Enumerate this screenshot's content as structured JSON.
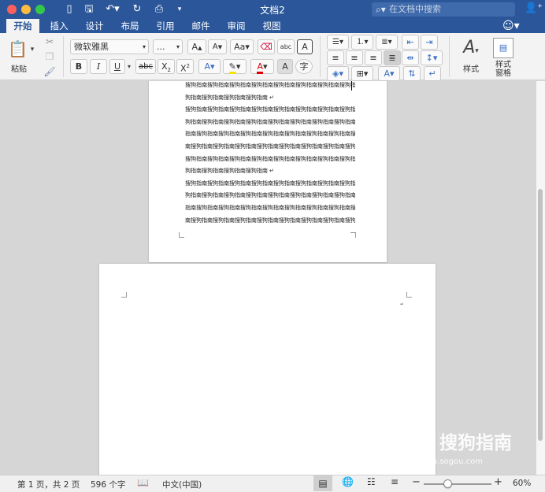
{
  "window": {
    "title": "文档2"
  },
  "search": {
    "placeholder": "在文档中搜索"
  },
  "tabs": [
    {
      "label": "开始",
      "active": true
    },
    {
      "label": "插入"
    },
    {
      "label": "设计"
    },
    {
      "label": "布局"
    },
    {
      "label": "引用"
    },
    {
      "label": "邮件"
    },
    {
      "label": "审阅"
    },
    {
      "label": "视图"
    }
  ],
  "ribbon": {
    "paste_label": "粘贴",
    "font_name": "微软雅黑",
    "font_size": "...",
    "bold": "B",
    "italic": "I",
    "underline": "U",
    "strike": "abc",
    "styles_label": "样式",
    "styles_pane_label": "样式\n窗格",
    "styles_pane_line1": "样式",
    "styles_pane_line2": "窗格"
  },
  "document": {
    "page1_lines": [
      "搜狗指南搜狗指南搜狗指南搜狗指南搜狗指南搜狗指南搜狗指南搜狗指南搜",
      "狗指南搜狗指南搜狗指南搜狗指南 ↵",
      "搜狗指南搜狗指南搜狗指南搜狗指南搜狗指南搜狗指南搜狗指南搜狗指南搜",
      "狗指南搜狗指南搜狗指南搜狗指南搜狗指南搜狗指南搜狗指南搜狗指南搜狗",
      "指南搜狗指南搜狗指南搜狗指南搜狗指南搜狗指南搜狗指南搜狗指南搜狗指",
      "南搜狗指南搜狗指南搜狗指南搜狗指南搜狗指南搜狗指南搜狗指南搜狗指南",
      "搜狗指南搜狗指南搜狗指南搜狗指南搜狗指南搜狗指南搜狗指南搜狗指南搜",
      "狗指南搜狗指南搜狗指南搜狗指南 ↵",
      "搜狗指南搜狗指南搜狗指南搜狗指南搜狗指南搜狗指南搜狗指南搜狗指南搜",
      "狗指南搜狗指南搜狗指南搜狗指南搜狗指南搜狗指南搜狗指南搜狗指南搜狗",
      "指南搜狗指南搜狗指南搜狗指南搜狗指南搜狗指南搜狗指南搜狗指南搜狗指",
      "南搜狗指南搜狗指南搜狗指南搜狗指南搜狗指南搜狗指南搜狗指南搜狗指南 ↵"
    ]
  },
  "watermark": {
    "text": "搜狗指南",
    "url": "zhinan.sogou.com"
  },
  "status": {
    "page": "第 1 页，共 2 页",
    "words": "596 个字",
    "language": "中文(中国)",
    "zoom": "60%",
    "zoom_level": 0.35
  }
}
